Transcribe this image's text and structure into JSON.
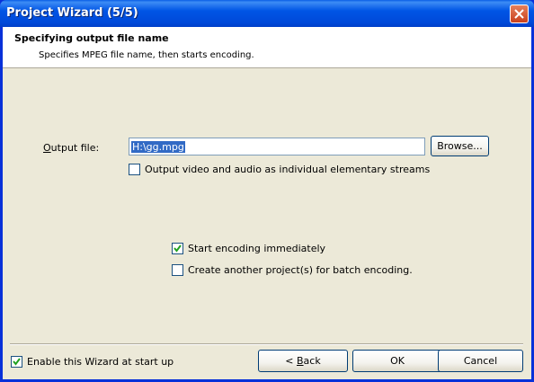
{
  "window": {
    "title": "Project Wizard (5/5)"
  },
  "header": {
    "title": "Specifying output file name",
    "subtitle": "Specifies MPEG file name, then starts encoding."
  },
  "output": {
    "label": "Output file:",
    "value": "H:\\gg.mpg",
    "browse_label": "Browse...",
    "elementary_streams_label": "Output video and audio as individual elementary streams",
    "elementary_streams_checked": false
  },
  "options": {
    "start_encoding_label": "Start encoding immediately",
    "start_encoding_checked": true,
    "batch_label": "Create another project(s) for batch encoding.",
    "batch_checked": false
  },
  "footer": {
    "enable_wizard_label": "Enable this Wizard at start up",
    "enable_wizard_checked": true,
    "back_arrow": "<",
    "back_label": "Back",
    "ok_label": "OK",
    "cancel_label": "Cancel"
  },
  "colors": {
    "titlebar": "#0055e5",
    "dialog_bg": "#ece9d8",
    "selection": "#316ac5"
  }
}
